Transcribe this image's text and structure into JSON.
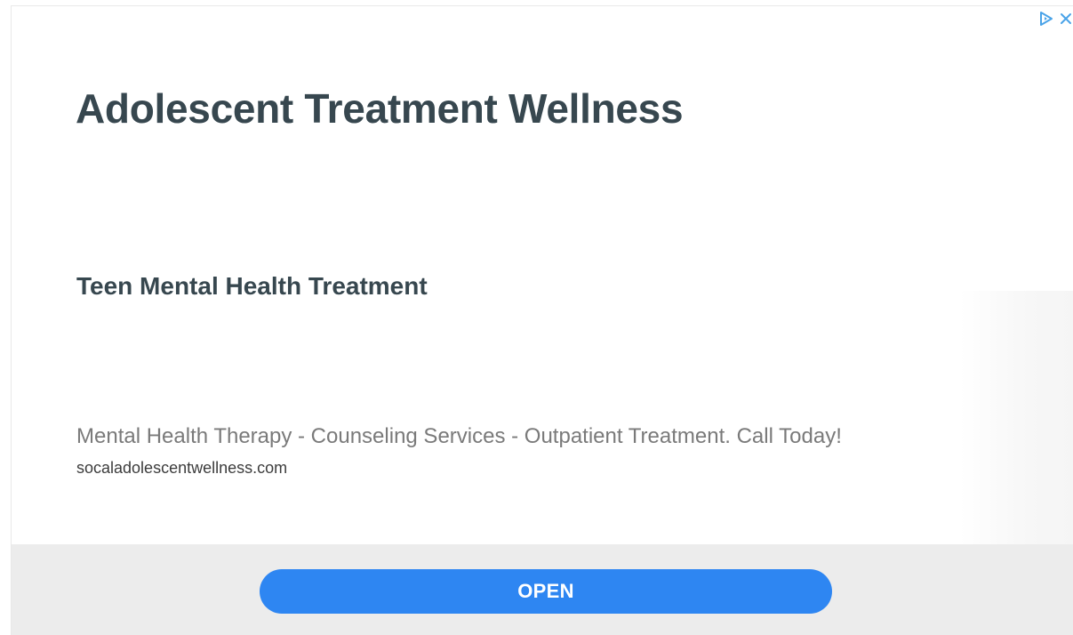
{
  "ad": {
    "headline": "Adolescent Treatment Wellness",
    "subheadline": "Teen Mental Health Treatment",
    "description": "Mental Health Therapy - Counseling Services - Outpatient Treatment. Call Today!",
    "display_url": "socaladolescentwellness.com",
    "cta_label": "OPEN",
    "icons": {
      "adchoices": "adchoices-triangle-icon",
      "close": "close-x-icon"
    },
    "colors": {
      "headline": "#37474f",
      "description": "#7a7a7a",
      "cta_background": "#2e86f2",
      "footer_background": "#ececec",
      "adchoices_icon": "#4aa3e8"
    }
  }
}
